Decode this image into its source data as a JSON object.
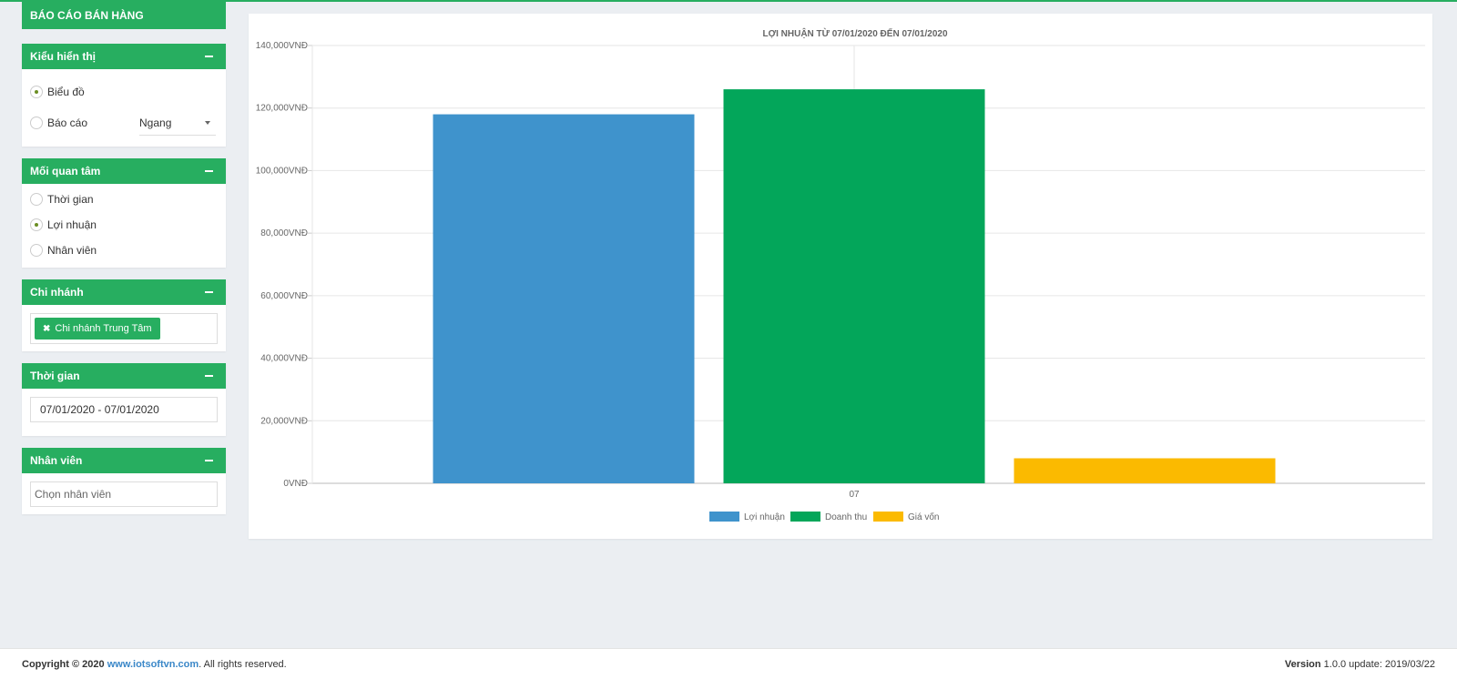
{
  "sidebar": {
    "report_title": "BÁO CÁO BÁN HÀNG",
    "display_panel": {
      "title": "Kiểu hiển thị",
      "options": [
        {
          "label": "Biểu đồ",
          "checked": true
        },
        {
          "label": "Báo cáo",
          "checked": false
        }
      ],
      "orientation_select": "Ngang"
    },
    "concern_panel": {
      "title": "Mối quan tâm",
      "options": [
        {
          "label": "Thời gian",
          "checked": false
        },
        {
          "label": "Lợi nhuận",
          "checked": true
        },
        {
          "label": "Nhân viên",
          "checked": false
        }
      ]
    },
    "branch_panel": {
      "title": "Chi nhánh",
      "selected_tag": "Chi nhánh Trung Tâm",
      "tag_remove_icon": "✖"
    },
    "time_panel": {
      "title": "Thời gian",
      "range": "07/01/2020 - 07/01/2020"
    },
    "staff_panel": {
      "title": "Nhân viên",
      "placeholder": "Chọn nhân viên"
    }
  },
  "chart_data": {
    "type": "bar",
    "title": "LỢI NHUẬN TỪ 07/01/2020 ĐẾN 07/01/2020",
    "categories": [
      "07"
    ],
    "series": [
      {
        "name": "Lợi nhuận",
        "values": [
          118000
        ],
        "color": "#3f93cc"
      },
      {
        "name": "Doanh thu",
        "values": [
          126000
        ],
        "color": "#03a65a"
      },
      {
        "name": "Giá vốn",
        "values": [
          8000
        ],
        "color": "#fbba00"
      }
    ],
    "ylim": [
      0,
      140000
    ],
    "yticks": [
      "0VNĐ",
      "20,000VNĐ",
      "40,000VNĐ",
      "60,000VNĐ",
      "80,000VNĐ",
      "100,000VNĐ",
      "120,000VNĐ",
      "140,000VNĐ"
    ],
    "ytick_values": [
      0,
      20000,
      40000,
      60000,
      80000,
      100000,
      120000,
      140000
    ],
    "grid": true,
    "legend": "bottom"
  },
  "footer": {
    "copyright_prefix": "Copyright © 2020",
    "site_link": "www.iotsoftvn.com",
    "copyright_suffix": ". All rights reserved.",
    "version_label": "Version",
    "version_text": "1.0.0 update: 2019/03/22"
  }
}
